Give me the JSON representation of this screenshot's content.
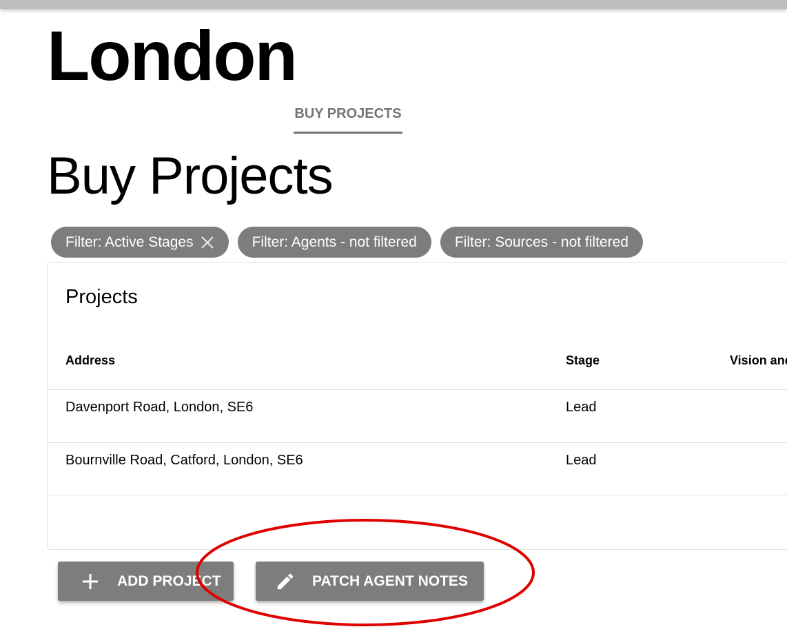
{
  "header": {
    "city_title": "London"
  },
  "tabs": [
    {
      "label": "BUY PROJECTS",
      "active": true
    }
  ],
  "page": {
    "title": "Buy Projects"
  },
  "filters": [
    {
      "label": "Filter: Active Stages",
      "removable": true,
      "icon": "close-icon"
    },
    {
      "label": "Filter: Agents - not filtered",
      "removable": false
    },
    {
      "label": "Filter: Sources - not filtered",
      "removable": false
    }
  ],
  "projects_table": {
    "title": "Projects",
    "columns": [
      "Address",
      "Stage",
      "Vision and"
    ],
    "rows": [
      {
        "address": "Davenport Road, London, SE6",
        "stage": "Lead"
      },
      {
        "address": "Bournville Road, Catford, London, SE6",
        "stage": "Lead"
      }
    ]
  },
  "actions": {
    "add_project": {
      "label": "ADD PROJECT",
      "icon": "plus-icon"
    },
    "patch_agent_notes": {
      "label": "PATCH AGENT NOTES",
      "icon": "pencil-icon"
    }
  },
  "colors": {
    "chip_bg": "#7d7d7d",
    "button_bg": "#7d7d7d",
    "top_bar": "#bdbdbd",
    "annotation": "#e00000"
  }
}
